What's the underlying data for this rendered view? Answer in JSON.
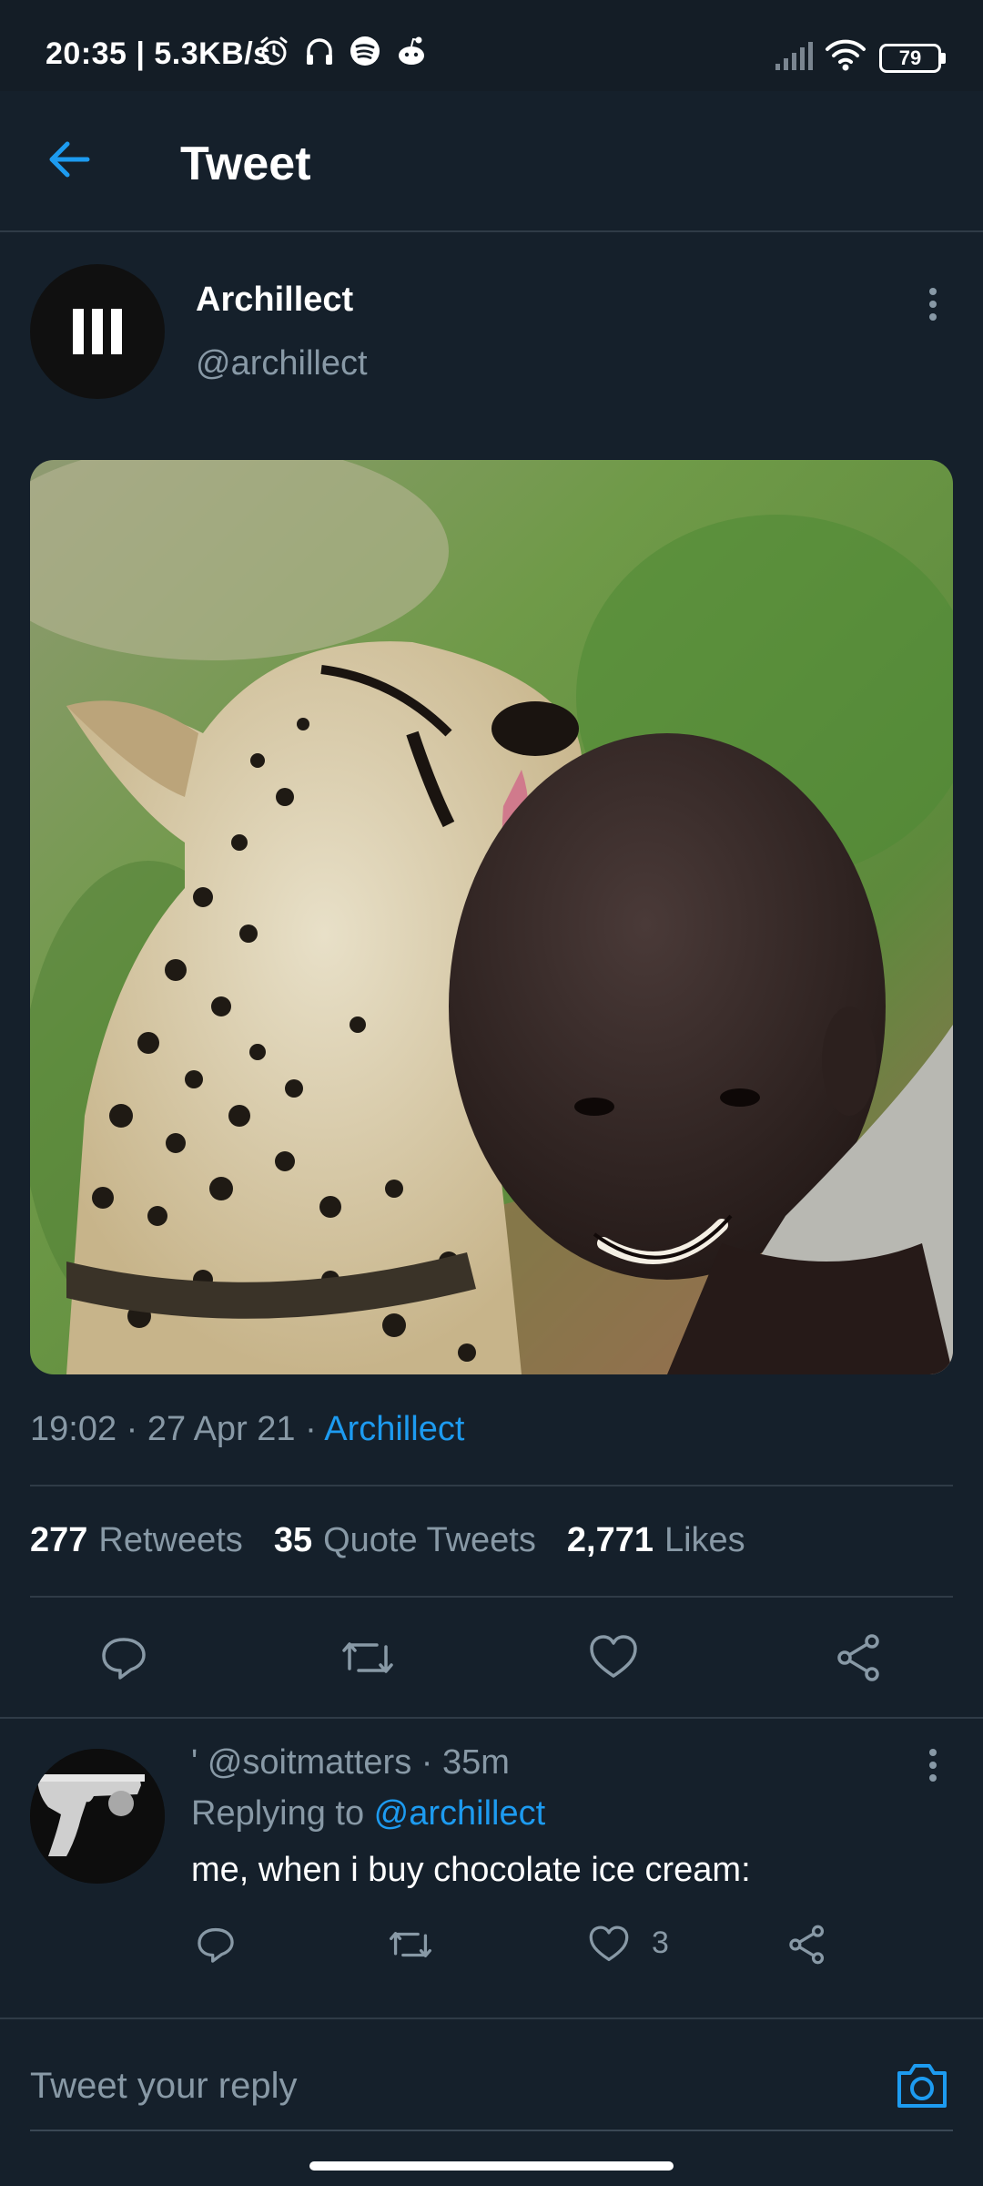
{
  "status_bar": {
    "time_speed": "20:35 | 5.3KB/s",
    "battery": "79",
    "icons": [
      "alarm-icon",
      "headphones-icon",
      "spotify-icon",
      "reddit-icon",
      "signal-icon",
      "wifi-icon",
      "battery-icon"
    ]
  },
  "header": {
    "title": "Tweet",
    "back_icon": "arrow-left-icon"
  },
  "tweet": {
    "author_name": "Archillect",
    "author_handle": "@archillect",
    "image_alt": "cheetah licking a smiling man's head",
    "timestamp": "19:02 · 27 Apr 21 · ",
    "source": "Archillect",
    "stats": {
      "retweets_count": "277",
      "retweets_label": "Retweets",
      "quotes_count": "35",
      "quotes_label": "Quote Tweets",
      "likes_count": "2,771",
      "likes_label": "Likes"
    }
  },
  "reply": {
    "meta": "' @soitmatters · 35m",
    "replying_prefix": "Replying to ",
    "replying_handle": "@archillect",
    "text": "me, when i buy chocolate ice cream:",
    "like_count": "3"
  },
  "compose": {
    "placeholder": "Tweet your reply"
  },
  "colors": {
    "background": "#15202b",
    "accent": "#1d9bf0",
    "secondary_text": "#8899a6",
    "divider": "#2f3b47"
  }
}
